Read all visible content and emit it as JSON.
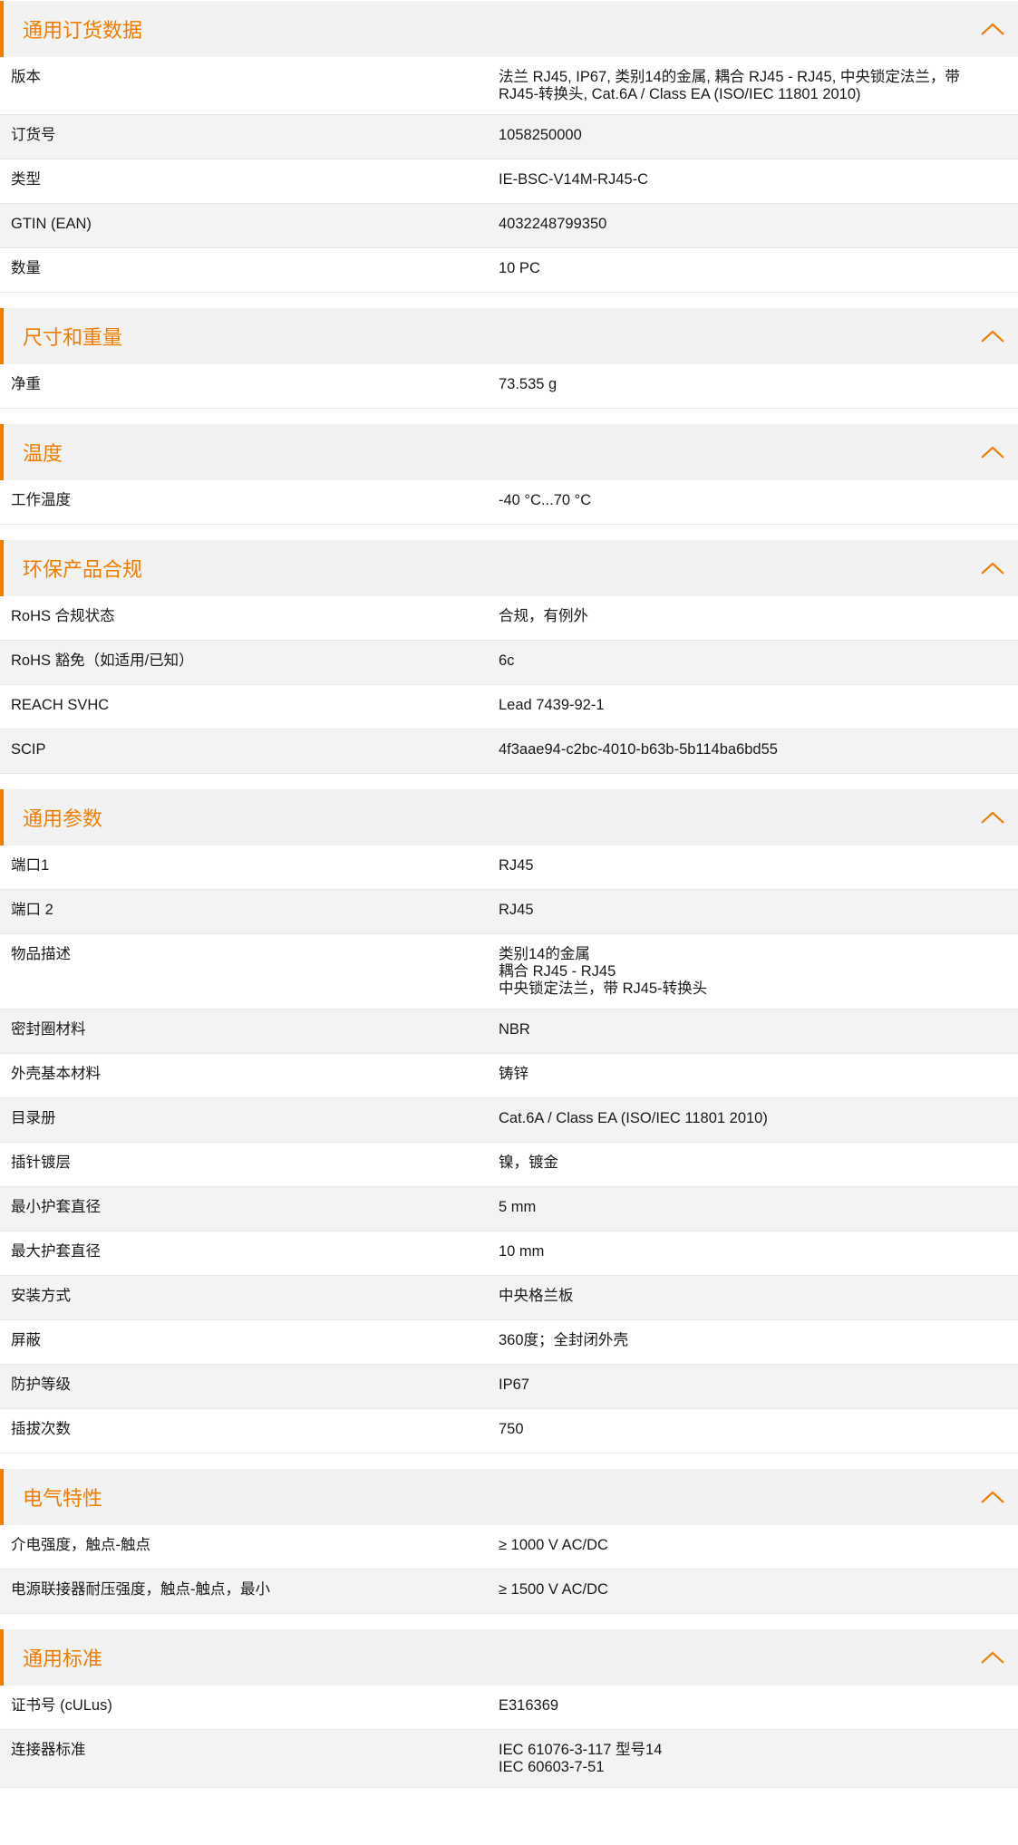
{
  "accent_color": "#f07d00",
  "sections": [
    {
      "title": "通用订货数据",
      "rows": [
        {
          "label": "版本",
          "value": [
            "法兰 RJ45, IP67, 类别14的金属, 耦合 RJ45 - RJ45, 中央锁定法兰，带 RJ45-转换头, Cat.6A / Class EA (ISO/IEC 11801 2010)"
          ]
        },
        {
          "label": "订货号",
          "value": [
            "1058250000"
          ]
        },
        {
          "label": "类型",
          "value": [
            "IE-BSC-V14M-RJ45-C"
          ]
        },
        {
          "label": "GTIN (EAN)",
          "value": [
            "4032248799350"
          ]
        },
        {
          "label": "数量",
          "value": [
            "10  PC"
          ]
        }
      ]
    },
    {
      "title": "尺寸和重量",
      "rows": [
        {
          "label": "净重",
          "value": [
            "73.535  g"
          ]
        }
      ]
    },
    {
      "title": "温度",
      "rows": [
        {
          "label": "工作温度",
          "value": [
            "-40 °C...70 °C"
          ]
        }
      ]
    },
    {
      "title": "环保产品合规",
      "rows": [
        {
          "label": "RoHS 合规状态",
          "value": [
            "合规，有例外"
          ]
        },
        {
          "label": "RoHS 豁免（如适用/已知）",
          "value": [
            "6c"
          ]
        },
        {
          "label": "REACH SVHC",
          "value": [
            "Lead 7439-92-1"
          ]
        },
        {
          "label": "SCIP",
          "value": [
            "4f3aae94-c2bc-4010-b63b-5b114ba6bd55"
          ]
        }
      ]
    },
    {
      "title": "通用参数",
      "rows": [
        {
          "label": "端口1",
          "value": [
            "RJ45"
          ]
        },
        {
          "label": "端口 2",
          "value": [
            "RJ45"
          ]
        },
        {
          "label": "物品描述",
          "value": [
            "类别14的金属",
            "耦合 RJ45 - RJ45",
            "中央锁定法兰，带 RJ45-转换头"
          ]
        },
        {
          "label": "密封圈材料",
          "value": [
            "NBR"
          ]
        },
        {
          "label": "外壳基本材料",
          "value": [
            "铸锌"
          ]
        },
        {
          "label": "目录册",
          "value": [
            "Cat.6A / Class EA (ISO/IEC 11801 2010)"
          ]
        },
        {
          "label": "插针镀层",
          "value": [
            "镍，镀金"
          ]
        },
        {
          "label": "最小护套直径",
          "value": [
            "5  mm"
          ]
        },
        {
          "label": "最大护套直径",
          "value": [
            "10  mm"
          ]
        },
        {
          "label": "安装方式",
          "value": [
            "中央格兰板"
          ]
        },
        {
          "label": "屏蔽",
          "value": [
            "360度；全封闭外壳"
          ]
        },
        {
          "label": "防护等级",
          "value": [
            "IP67"
          ]
        },
        {
          "label": "插拔次数",
          "value": [
            "750"
          ]
        }
      ]
    },
    {
      "title": "电气特性",
      "rows": [
        {
          "label": "介电强度，触点-触点",
          "value": [
            "≥ 1000 V AC/DC"
          ]
        },
        {
          "label": "电源联接器耐压强度，触点-触点，最小",
          "value": [
            "≥ 1500 V AC/DC"
          ]
        }
      ]
    },
    {
      "title": "通用标准",
      "rows": [
        {
          "label": "证书号 (cULus)",
          "value": [
            "E316369"
          ]
        },
        {
          "label": "连接器标准",
          "value": [
            "IEC 61076-3-117 型号14",
            "IEC 60603-7-51"
          ]
        }
      ]
    }
  ]
}
